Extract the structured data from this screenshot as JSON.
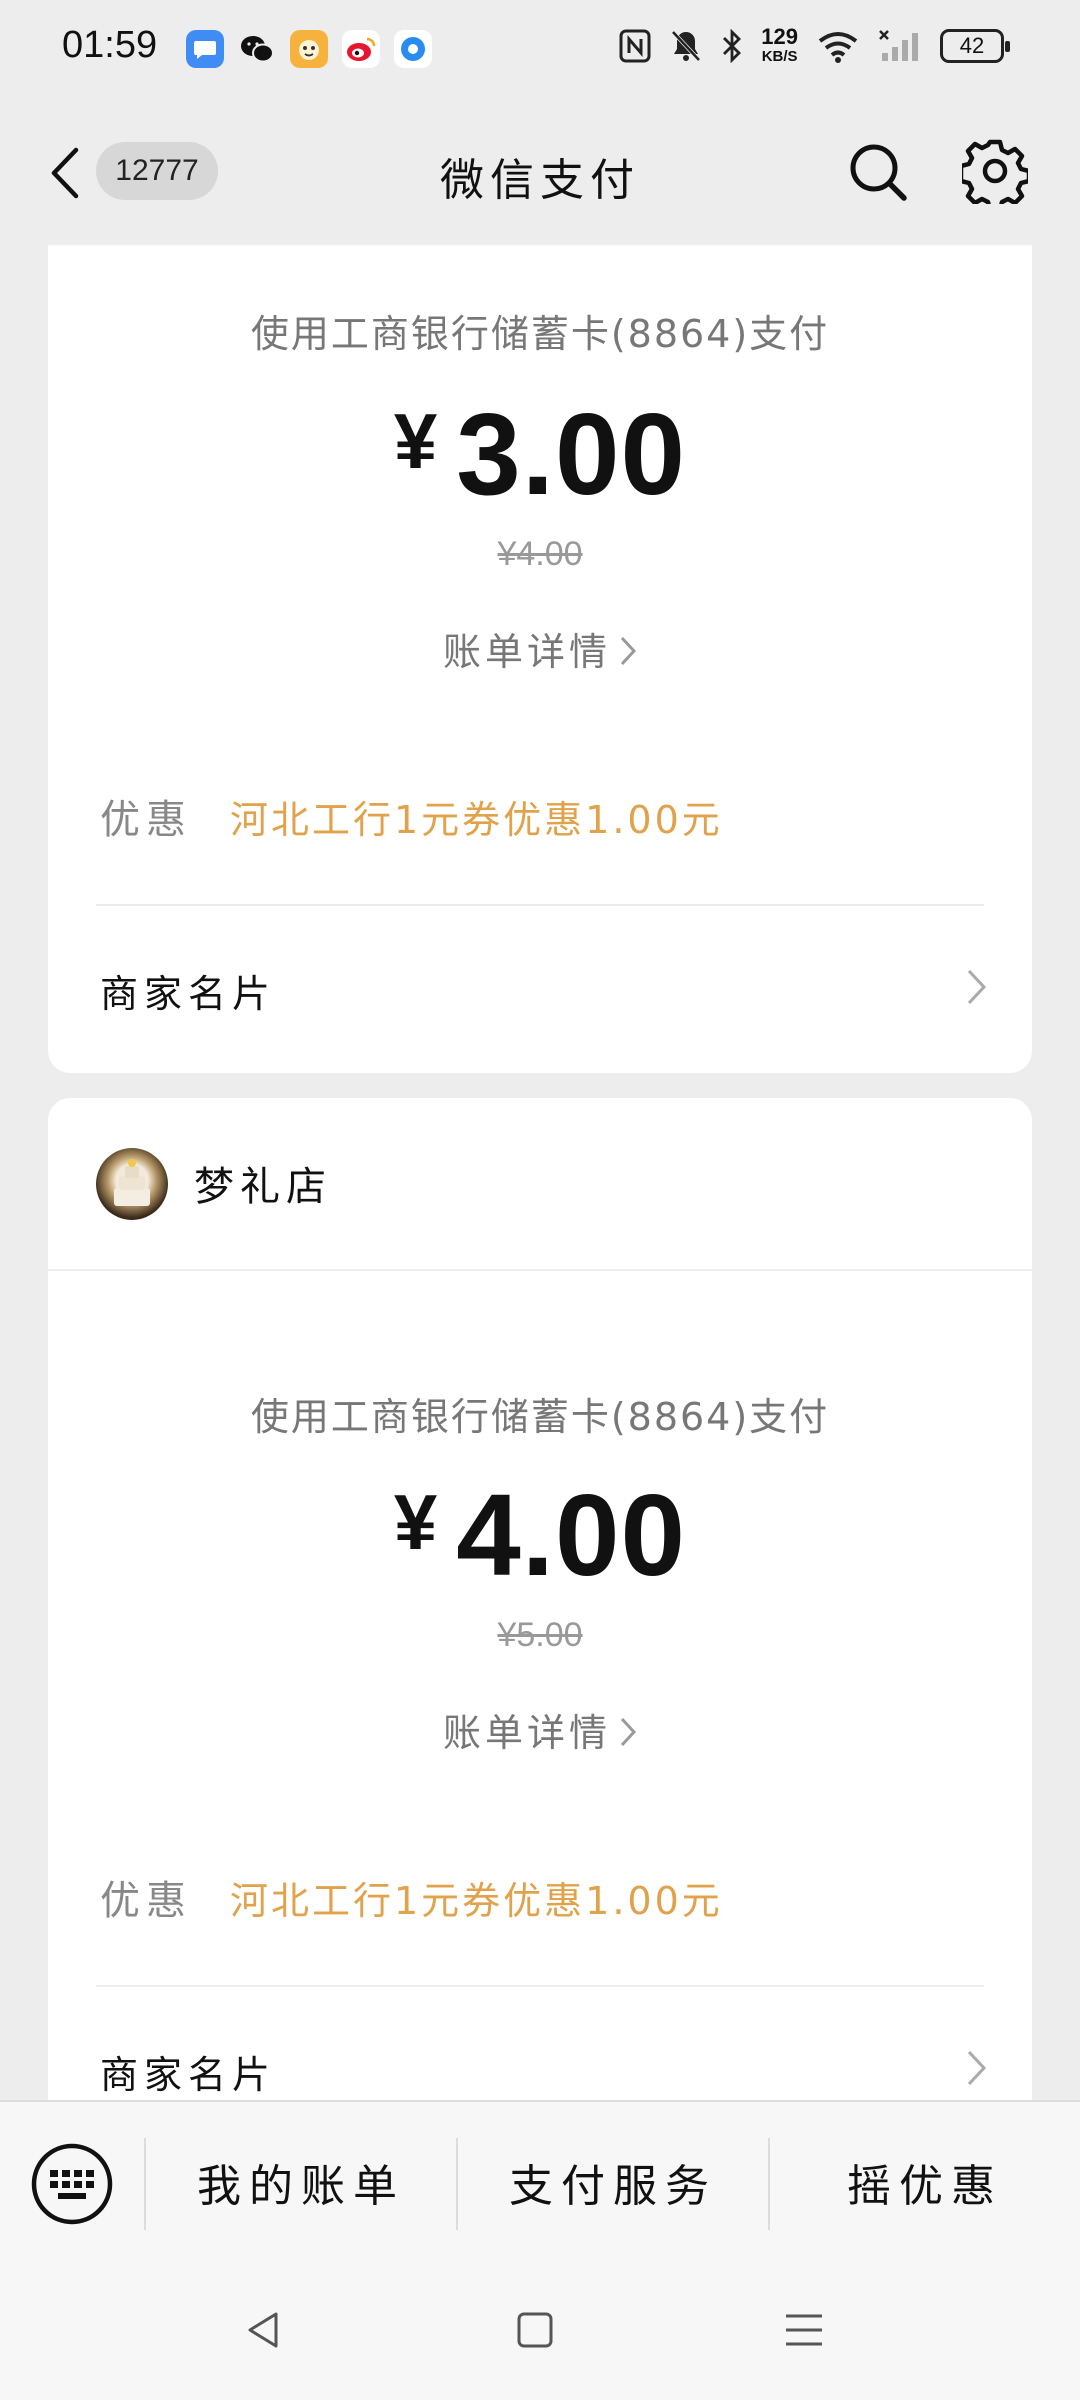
{
  "status_bar": {
    "time": "01:59",
    "net_speed_value": "129",
    "net_speed_unit": "KB/S",
    "battery": "42",
    "icons": [
      "messages-app-icon",
      "wechat-icon",
      "game-app-icon",
      "weibo-icon",
      "browser-icon",
      "nfc-icon",
      "mute-bell-icon",
      "bluetooth-icon",
      "wifi-icon",
      "signal-icon",
      "battery-icon"
    ]
  },
  "nav": {
    "unread_count": "12777",
    "title": "微信支付"
  },
  "cards": [
    {
      "pay_method": "使用工商银行储蓄卡(8864)支付",
      "currency": "¥",
      "amount": "3.00",
      "original_amount": "¥4.00",
      "bill_detail": "账单详情",
      "discount_label": "优惠",
      "discount_value": "河北工行1元券优惠1.00元",
      "merchant_card": "商家名片"
    },
    {
      "store_name": "梦礼店",
      "pay_method": "使用工商银行储蓄卡(8864)支付",
      "currency": "¥",
      "amount": "4.00",
      "original_amount": "¥5.00",
      "bill_detail": "账单详情",
      "discount_label": "优惠",
      "discount_value": "河北工行1元券优惠1.00元",
      "merchant_card": "商家名片"
    }
  ],
  "bottom_menu": {
    "items": [
      "我的账单",
      "支付服务",
      "摇优惠"
    ]
  },
  "colors": {
    "background": "#ededed",
    "card": "#ffffff",
    "discount": "#e0a24a",
    "muted_text": "#777777"
  }
}
